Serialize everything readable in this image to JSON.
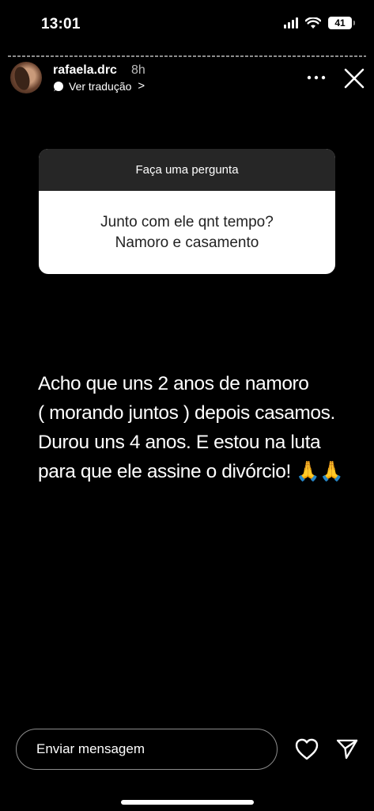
{
  "status_bar": {
    "time": "13:01",
    "battery": "41"
  },
  "story_header": {
    "username": "rafaela.drc",
    "time_ago": "8h",
    "translate_label": "Ver tradução",
    "translate_chevron": ">"
  },
  "question_sticker": {
    "header": "Faça uma pergunta",
    "question_lines": [
      "Junto com ele qnt tempo?",
      "Namoro e casamento"
    ]
  },
  "answer": {
    "lines": [
      "Acho que uns 2 anos de namoro",
      "( morando juntos ) depois casamos.",
      "Durou uns 4 anos. E estou na luta",
      "para que ele assine o divórcio! 🙏🙏"
    ]
  },
  "footer": {
    "message_placeholder": "Enviar mensagem"
  },
  "icons": {
    "signal": "signal-icon",
    "wifi": "wifi-icon",
    "battery": "battery-icon",
    "translate": "translate-icon",
    "more": "more-icon",
    "close": "close-icon",
    "heart": "heart-icon",
    "send": "send-icon"
  }
}
